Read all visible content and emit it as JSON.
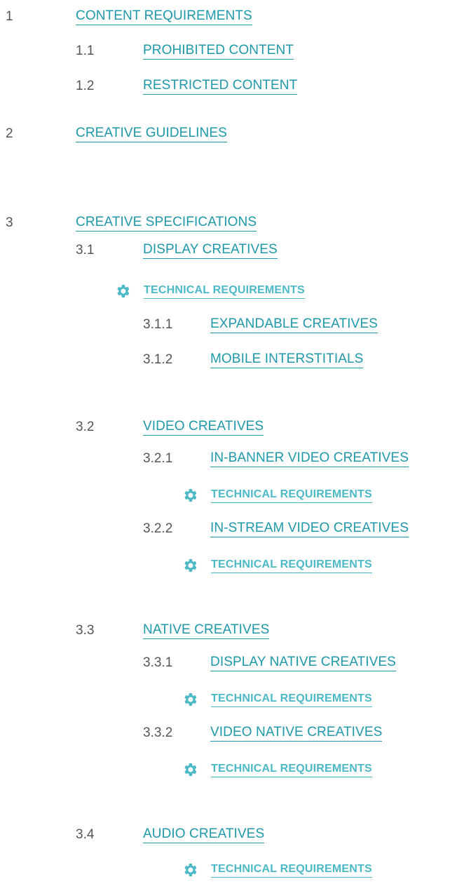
{
  "toc": {
    "s1": {
      "num": "1",
      "label": "CONTENT REQUIREMENTS"
    },
    "s1_1": {
      "num": "1.1",
      "label": "PROHIBITED CONTENT"
    },
    "s1_2": {
      "num": "1.2",
      "label": "RESTRICTED CONTENT"
    },
    "s2": {
      "num": "2",
      "label": "CREATIVE GUIDELINES"
    },
    "s3": {
      "num": "3",
      "label": "CREATIVE SPECIFICATIONS"
    },
    "s3_1": {
      "num": "3.1",
      "label": "DISPLAY CREATIVES"
    },
    "s3_1_tech": {
      "label": "TECHNICAL REQUIREMENTS",
      "icon": "gear-icon"
    },
    "s3_1_1": {
      "num": "3.1.1",
      "label": "EXPANDABLE CREATIVES"
    },
    "s3_1_2": {
      "num": "3.1.2",
      "label": "MOBILE INTERSTITIALS"
    },
    "s3_2": {
      "num": "3.2",
      "label": "VIDEO CREATIVES"
    },
    "s3_2_1": {
      "num": "3.2.1",
      "label": "IN-BANNER VIDEO CREATIVES"
    },
    "s3_2_1_tech": {
      "label": "TECHNICAL REQUIREMENTS",
      "icon": "gear-icon"
    },
    "s3_2_2": {
      "num": "3.2.2",
      "label": "IN-STREAM VIDEO CREATIVES"
    },
    "s3_2_2_tech": {
      "label": "TECHNICAL REQUIREMENTS",
      "icon": "gear-icon"
    },
    "s3_3": {
      "num": "3.3",
      "label": "NATIVE CREATIVES"
    },
    "s3_3_1": {
      "num": "3.3.1",
      "label": "DISPLAY NATIVE CREATIVES"
    },
    "s3_3_1_tech": {
      "label": "TECHNICAL REQUIREMENTS",
      "icon": "gear-icon"
    },
    "s3_3_2": {
      "num": "3.3.2",
      "label": "VIDEO NATIVE CREATIVES"
    },
    "s3_3_2_tech": {
      "label": "TECHNICAL REQUIREMENTS",
      "icon": "gear-icon"
    },
    "s3_4": {
      "num": "3.4",
      "label": "AUDIO CREATIVES"
    },
    "s3_4_tech": {
      "label": "TECHNICAL REQUIREMENTS",
      "icon": "gear-icon"
    }
  },
  "colors": {
    "link": "#1f98a9",
    "tech_link": "#4cb9c6",
    "number": "#555555",
    "icon": "#4cb9c6"
  }
}
